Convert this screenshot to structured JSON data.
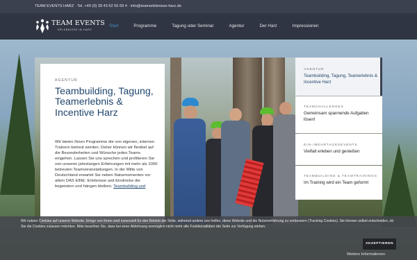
{
  "topbar": {
    "company": "TEAM EVENTS HARZ",
    "phone": "Tel. +49 (0) 39 43 62 55 69 4",
    "email": "info@teamerlebnisse-harz.de"
  },
  "logo": {
    "name": "TEAM EVENTS",
    "tagline": "ERLEBNISSE IM HARZ"
  },
  "menu": [
    "Start",
    "Programme",
    "Tagung oder Seminar",
    "Agentur",
    "Der Harz",
    "Impressionen"
  ],
  "content": {
    "eyebrow": "AGENTUR",
    "title": "Teambuilding, Tagung, Teamerlebnis & Incentive Harz",
    "body_start": "Wir bieten Ihnen Programme die von eigenen, internen Trainern betreut werden. Daher können wir flexibel auf die Besonderheiten und Wünsche jedes Teams eingehen. Lassen Sie uns sprechen und profitieren Sie von unseren jahrelangen Erfahrungen mit mehr als 1000 betreuten Teamveranstaltungen. In der Mitte von Deutschland erwartet Sie neben Naturmomenten vor allem DAS EINE: Erlebnisse und Eindrücke die begeistern und hängen bleiben.",
    "body_link": "Teambuilding und"
  },
  "sidebar": [
    {
      "label": "AGENTUR",
      "text": "Teambuilding, Tagung, Teamerlebnis & Incentive Harz"
    },
    {
      "label": "TEAMCHALLENGES",
      "text": "Gemeinsam spannende Aufgaben lösen!"
    },
    {
      "label": "EIN-/MEHRTAGESEVENTS",
      "text": "Vielfalt erleben und genießen"
    },
    {
      "label": "TEAMBUILDING & TEAMTRAININGS",
      "text": "Im Training wird ein Team geformt"
    }
  ],
  "cookie": {
    "message": "Wir nutzen Cookies auf unserer Website. Einige von ihnen sind essenziell für den Betrieb der Seite, während andere uns helfen, diese Website und die Nutzererfahrung zu verbessern (Tracking Cookies). Sie können selbst entscheiden, ob Sie die Cookies zulassen möchten. Bitte beachten Sie, dass bei einer Ablehnung womöglich nicht mehr alle Funktionalitäten der Seite zur Verfügung stehen.",
    "accept_label": "AKZEPTIEREN",
    "more_label": "Weitere Informationen"
  },
  "colors": {
    "accent": "#4a8fc4",
    "title_blue": "#20466e",
    "topbar": "#3c4150",
    "nav": "#2f3542"
  }
}
